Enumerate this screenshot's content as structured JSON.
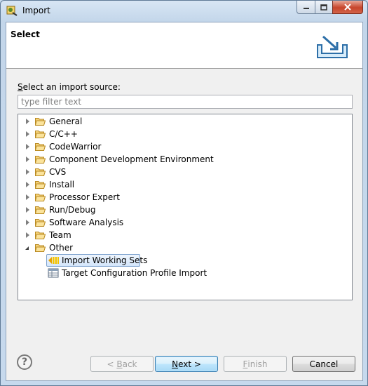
{
  "window": {
    "title": "Import"
  },
  "banner": {
    "title": "Select"
  },
  "prompt": {
    "label": "Select an import source:",
    "mnemonic": "S",
    "rest": "elect an import source:"
  },
  "filter": {
    "placeholder": "type filter text",
    "value": ""
  },
  "tree": {
    "items": [
      {
        "label": "General",
        "expanded": false
      },
      {
        "label": "C/C++",
        "expanded": false
      },
      {
        "label": "CodeWarrior",
        "expanded": false
      },
      {
        "label": "Component Development Environment",
        "expanded": false
      },
      {
        "label": "CVS",
        "expanded": false
      },
      {
        "label": "Install",
        "expanded": false
      },
      {
        "label": "Processor Expert",
        "expanded": false
      },
      {
        "label": "Run/Debug",
        "expanded": false
      },
      {
        "label": "Software Analysis",
        "expanded": false
      },
      {
        "label": "Team",
        "expanded": false
      },
      {
        "label": "Other",
        "expanded": true
      }
    ],
    "children": [
      {
        "label": "Import Working Sets",
        "icon": "import-working-sets-icon",
        "selected": true
      },
      {
        "label": "Target Configuration Profile Import",
        "icon": "table-icon",
        "selected": false
      }
    ]
  },
  "buttons": {
    "help": "?",
    "back": {
      "label": "< Back",
      "pre": "< ",
      "mnemonic": "B",
      "post": "ack",
      "enabled": false
    },
    "next": {
      "label": "Next >",
      "mnemonic": "N",
      "post": "ext >",
      "enabled": true
    },
    "finish": {
      "label": "Finish",
      "mnemonic": "F",
      "post": "inish",
      "enabled": false
    },
    "cancel": {
      "label": "Cancel",
      "enabled": true
    }
  },
  "colors": {
    "accent": "#3c7fb1",
    "folder": "#e8b64c",
    "selection": "#d4e6fb"
  }
}
